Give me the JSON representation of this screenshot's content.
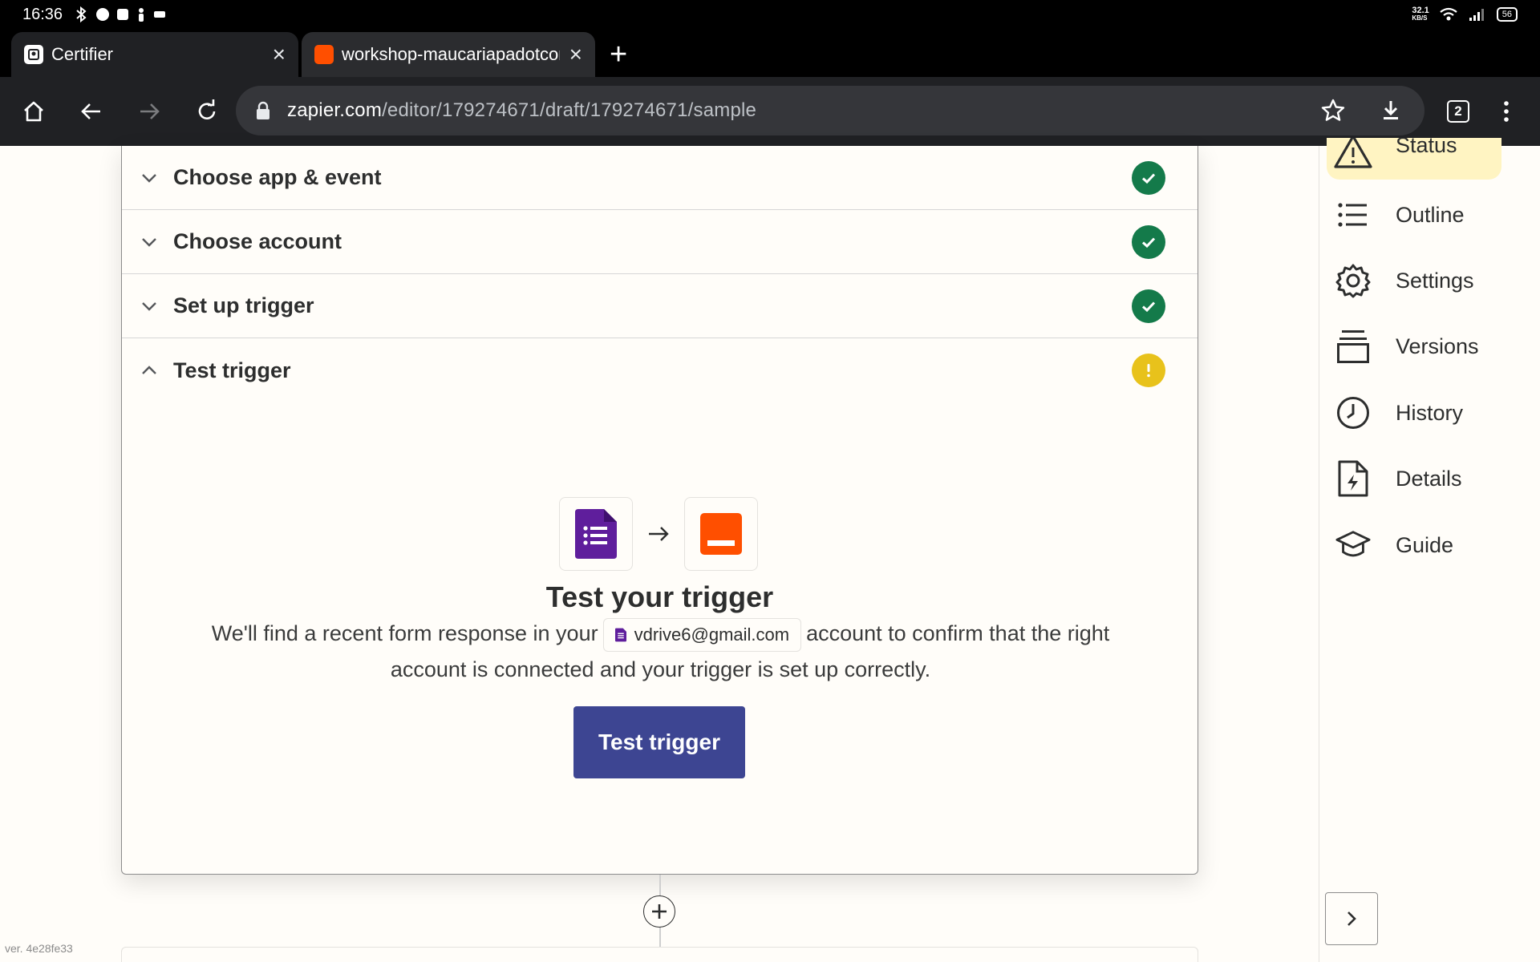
{
  "status_bar": {
    "time": "16:36",
    "net_speed_value": "32.1",
    "net_speed_unit": "KB/S",
    "battery": "56"
  },
  "tabs": [
    {
      "title": "Certifier",
      "icon": "certifier-favicon",
      "active": true
    },
    {
      "title": "workshop-maucariapadotcom",
      "icon": "zapier-favicon",
      "active": false
    }
  ],
  "toolbar": {
    "url_host": "zapier.com",
    "url_path": "/editor/179274671/draft/179274671/sample",
    "tab_count": "2"
  },
  "steps": [
    {
      "label": "Choose app & event",
      "state": "complete"
    },
    {
      "label": "Choose account",
      "state": "complete"
    },
    {
      "label": "Set up trigger",
      "state": "complete"
    },
    {
      "label": "Test trigger",
      "state": "warning"
    }
  ],
  "test_panel": {
    "title": "Test your trigger",
    "desc_before": "We'll find a recent form response in your",
    "account_email": "vdrive6@gmail.com",
    "desc_after": "account to confirm that the right account is connected and your trigger is set up correctly.",
    "button_label": "Test trigger"
  },
  "sidebar": {
    "status_label": "Status",
    "items": [
      {
        "label": "Outline",
        "icon": "list-icon"
      },
      {
        "label": "Settings",
        "icon": "gear-icon"
      },
      {
        "label": "Versions",
        "icon": "stack-icon"
      },
      {
        "label": "History",
        "icon": "clock-icon"
      },
      {
        "label": "Details",
        "icon": "file-bolt-icon"
      },
      {
        "label": "Guide",
        "icon": "graduation-cap-icon"
      }
    ]
  },
  "footer": {
    "version": "ver. 4e28fe33"
  },
  "colors": {
    "success": "#147a4a",
    "warning": "#e8c21b",
    "primary_button": "#3d4592",
    "forms_purple": "#5f1e9c",
    "zapier_orange": "#ff4f00",
    "status_highlight": "#fff4c2"
  }
}
